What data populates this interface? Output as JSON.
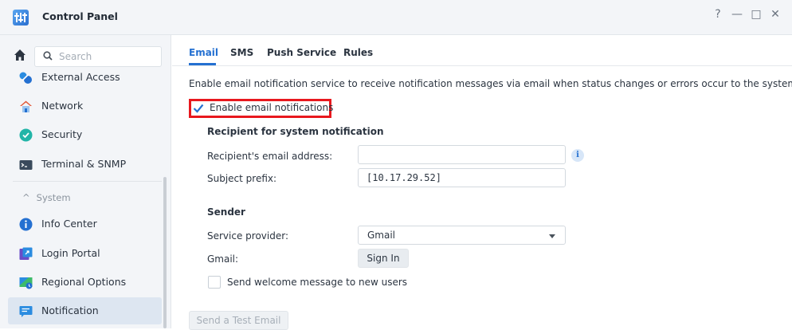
{
  "window": {
    "title": "Control Panel",
    "controls": {
      "help": "?",
      "minimize": "—",
      "maximize": "□",
      "close": "✕"
    }
  },
  "sidebar": {
    "search": {
      "placeholder": "Search",
      "value": ""
    },
    "items": [
      {
        "label": "External Access",
        "icon": "external-access-icon"
      },
      {
        "label": "Network",
        "icon": "network-icon"
      },
      {
        "label": "Security",
        "icon": "security-icon"
      },
      {
        "label": "Terminal & SNMP",
        "icon": "terminal-icon"
      }
    ],
    "group": {
      "label": "System",
      "chevron": "^"
    },
    "group_items": [
      {
        "label": "Info Center",
        "icon": "info-center-icon"
      },
      {
        "label": "Login Portal",
        "icon": "login-portal-icon"
      },
      {
        "label": "Regional Options",
        "icon": "regional-options-icon"
      },
      {
        "label": "Notification",
        "icon": "notification-icon",
        "active": true
      }
    ]
  },
  "main": {
    "tabs": [
      {
        "label": "Email",
        "active": true
      },
      {
        "label": "SMS"
      },
      {
        "label": "Push Service"
      },
      {
        "label": "Rules"
      }
    ],
    "description": "Enable email notification service to receive notification messages via email when status changes or errors occur to the system.",
    "enable_checkbox": {
      "label": "Enable email notifications",
      "checked": true
    },
    "recipient": {
      "title": "Recipient for system notification",
      "email_label": "Recipient's email address:",
      "email_value": "",
      "info_glyph": "i",
      "prefix_label": "Subject prefix:",
      "prefix_value": "[10.17.29.52]"
    },
    "sender": {
      "title": "Sender",
      "provider_label": "Service provider:",
      "provider_value": "Gmail",
      "gmail_label": "Gmail:",
      "sign_in_label": "Sign In",
      "welcome_label": "Send welcome message to new users",
      "welcome_checked": false
    },
    "test_button_label": "Send a Test Email"
  },
  "colors": {
    "accent": "#2470d1",
    "highlight_border": "#e8181e",
    "sidebar_bg": "#f3f5f8",
    "active_item_bg": "#dde6f1"
  }
}
